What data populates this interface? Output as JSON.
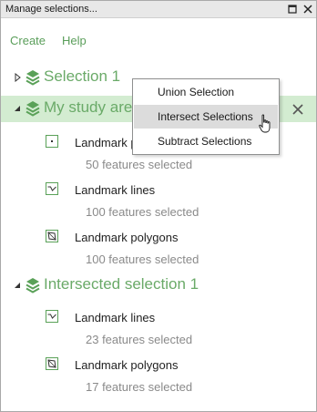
{
  "window": {
    "title": "Manage selections...",
    "restore_icon": "restore-window-icon",
    "close_icon": "close-window-icon"
  },
  "menu": {
    "create": "Create",
    "help": "Help"
  },
  "colors": {
    "accent_green": "#6aaa68",
    "highlight_green": "#d3ecd1",
    "menu_hover": "#dcdcdc"
  },
  "groups": [
    {
      "label": "Selection 1",
      "expanded": false,
      "icon": "layers-stack-icon"
    },
    {
      "label": "My study area",
      "expanded": true,
      "selected": true,
      "icon": "layers-stack-icon",
      "remove_icon": "close-icon",
      "layers": [
        {
          "name": "Landmark points",
          "count": "50 features selected",
          "icon": "point-layer-icon"
        },
        {
          "name": "Landmark lines",
          "count": "100 features selected",
          "icon": "line-layer-icon"
        },
        {
          "name": "Landmark polygons",
          "count": "100 features selected",
          "icon": "polygon-layer-icon"
        }
      ]
    },
    {
      "label": "Intersected selection 1",
      "expanded": true,
      "icon": "layers-stack-icon",
      "layers": [
        {
          "name": "Landmark lines",
          "count": "23 features selected",
          "icon": "line-layer-icon"
        },
        {
          "name": "Landmark polygons",
          "count": "17 features selected",
          "icon": "polygon-layer-icon"
        }
      ]
    }
  ],
  "context_menu": {
    "items": [
      {
        "label": "Union Selection",
        "hovered": false
      },
      {
        "label": "Intersect Selections",
        "hovered": true
      },
      {
        "label": "Subtract Selections",
        "hovered": false
      }
    ],
    "cursor_icon": "hand-pointer-icon"
  }
}
